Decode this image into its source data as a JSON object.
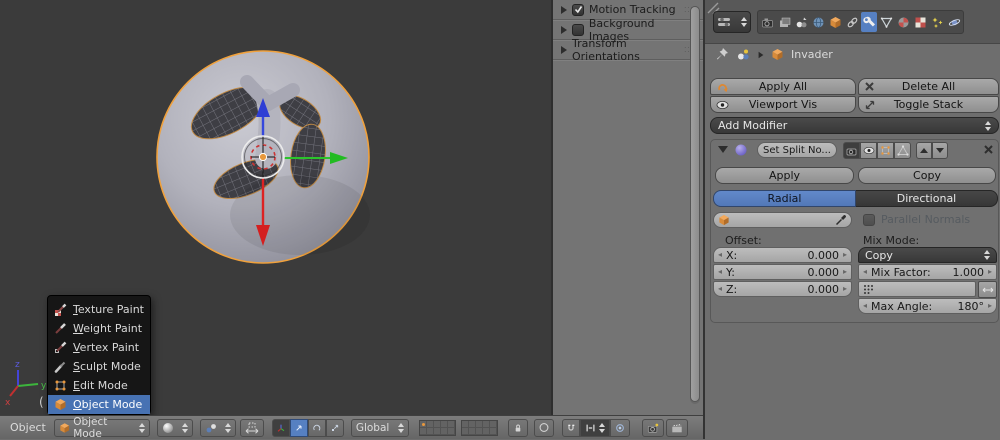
{
  "colors": {
    "accent_blue": "#5680c2",
    "menu_highlight": "#4772b3",
    "selection_orange": "#f0a13c",
    "viewport_bg": "#3b3b3b",
    "panel_bg": "#747474"
  },
  "viewport": {
    "partial_overlay_text": "(",
    "mini_axis": {
      "x": "x",
      "y": "y",
      "z": "z"
    }
  },
  "mode_menu": {
    "items": [
      {
        "key": "T",
        "rest": "exture Paint"
      },
      {
        "key": "W",
        "rest": "eight Paint"
      },
      {
        "key": "V",
        "rest": "ertex Paint"
      },
      {
        "key": "S",
        "rest": "culpt Mode"
      },
      {
        "key": "E",
        "rest": "dit Mode"
      },
      {
        "key": "O",
        "rest": "bject Mode",
        "selected": true
      }
    ]
  },
  "side_panel": {
    "items": [
      {
        "label": "Motion Tracking",
        "checked": true
      },
      {
        "label": "Background Images",
        "checked": false
      },
      {
        "label": "Transform Orientations"
      }
    ]
  },
  "header": {
    "object_menu": "Object",
    "mode_selector": "Object Mode",
    "orientation": "Global"
  },
  "properties": {
    "breadcrumb_object": "Invader",
    "apply_all": "Apply All",
    "delete_all": "Delete All",
    "viewport_vis": "Viewport Vis",
    "toggle_stack": "Toggle Stack",
    "add_modifier": "Add Modifier",
    "modifier": {
      "name": "Set Split No...",
      "apply": "Apply",
      "copy": "Copy",
      "radial": "Radial",
      "directional": "Directional",
      "parallel_normals": "Parallel Normals",
      "offset_label": "Offset:",
      "mix_mode_label": "Mix Mode:",
      "x_label": "X:",
      "x_value": "0.000",
      "y_label": "Y:",
      "y_value": "0.000",
      "z_label": "Z:",
      "z_value": "0.000",
      "mix_mode_value": "Copy",
      "mix_factor_label": "Mix Factor:",
      "mix_factor_value": "1.000",
      "max_angle_label": "Max Angle:",
      "max_angle_value": "180°"
    }
  }
}
